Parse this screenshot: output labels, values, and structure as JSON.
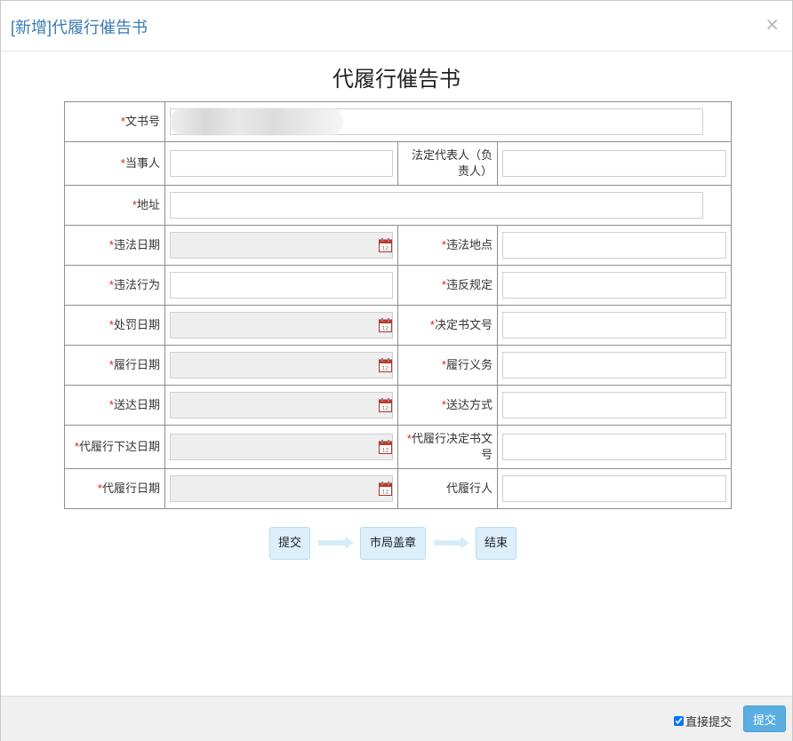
{
  "header": {
    "title": "[新增]代履行催告书",
    "close_label": "×"
  },
  "doc_title": "代履行催告书",
  "required_mark": "*",
  "fields": {
    "doc_no": {
      "label": "文书号",
      "value": ""
    },
    "party": {
      "label": "当事人",
      "value": ""
    },
    "legal_rep": {
      "label": "法定代表人（负责人）",
      "value": ""
    },
    "address": {
      "label": "地址",
      "value": ""
    },
    "violation_date": {
      "label": "违法日期",
      "value": ""
    },
    "violation_place": {
      "label": "违法地点",
      "value": ""
    },
    "violation_act": {
      "label": "违法行为",
      "value": ""
    },
    "violated_rule": {
      "label": "违反规定",
      "value": ""
    },
    "penalty_date": {
      "label": "处罚日期",
      "value": ""
    },
    "decision_no": {
      "label": "决定书文号",
      "value": ""
    },
    "perform_date": {
      "label": "履行日期",
      "value": ""
    },
    "perform_duty": {
      "label": "履行义务",
      "value": ""
    },
    "deliver_date": {
      "label": "送达日期",
      "value": ""
    },
    "deliver_method": {
      "label": "送达方式",
      "value": ""
    },
    "proxy_issue_date": {
      "label": "代履行下达日期",
      "value": ""
    },
    "proxy_decision_no": {
      "label": "代履行决定书文号",
      "value": ""
    },
    "proxy_date": {
      "label": "代履行日期",
      "value": ""
    },
    "proxy_person": {
      "label": "代履行人",
      "value": ""
    }
  },
  "flow": {
    "steps": [
      "提交",
      "市局盖章",
      "结束"
    ]
  },
  "footer": {
    "direct_submit_label": "直接提交",
    "direct_submit_checked": true,
    "submit_label": "提交"
  },
  "colors": {
    "accent": "#5aaee2",
    "title": "#3a7bb2",
    "required": "#e02020",
    "step_bg": "#dceffb"
  }
}
